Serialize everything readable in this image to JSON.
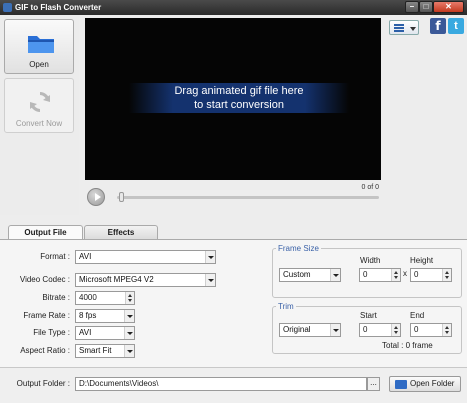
{
  "window": {
    "title": "GIF to Flash Converter",
    "min": "–",
    "max": "□",
    "close": "✕"
  },
  "sidebar": {
    "open_label": "Open",
    "convert_label": "Convert Now"
  },
  "player": {
    "drop_text_line1": "Drag animated gif file here",
    "drop_text_line2": "to start conversion",
    "frame_counter": "0 of 0",
    "progress": 0
  },
  "social": {
    "facebook_glyph": "f",
    "twitter_glyph": "t"
  },
  "tabs": [
    {
      "label": "Output File"
    },
    {
      "label": "Effects"
    }
  ],
  "output": {
    "format_label": "Format :",
    "format_value": "AVI",
    "codec_label": "Video Codec :",
    "codec_value": "Microsoft MPEG4 V2",
    "bitrate_label": "Bitrate :",
    "bitrate_value": "4000",
    "framerate_label": "Frame Rate :",
    "framerate_value": "8 fps",
    "filetype_label": "File Type :",
    "filetype_value": "AVI",
    "aspect_label": "Aspect Ratio :",
    "aspect_value": "Smart Fit"
  },
  "frame_size": {
    "title": "Frame Size",
    "preset": "Custom",
    "width_label": "Width",
    "width_value": "0",
    "times": "x",
    "height_label": "Height",
    "height_value": "0"
  },
  "trim": {
    "title": "Trim",
    "preset": "Original",
    "start_label": "Start",
    "start_value": "0",
    "end_label": "End",
    "end_value": "0",
    "total": "Total : 0 frame"
  },
  "footer": {
    "folder_label": "Output Folder :",
    "folder_path": "D:\\Documents\\Videos\\",
    "browse_label": "...",
    "open_folder_label": "Open Folder"
  }
}
